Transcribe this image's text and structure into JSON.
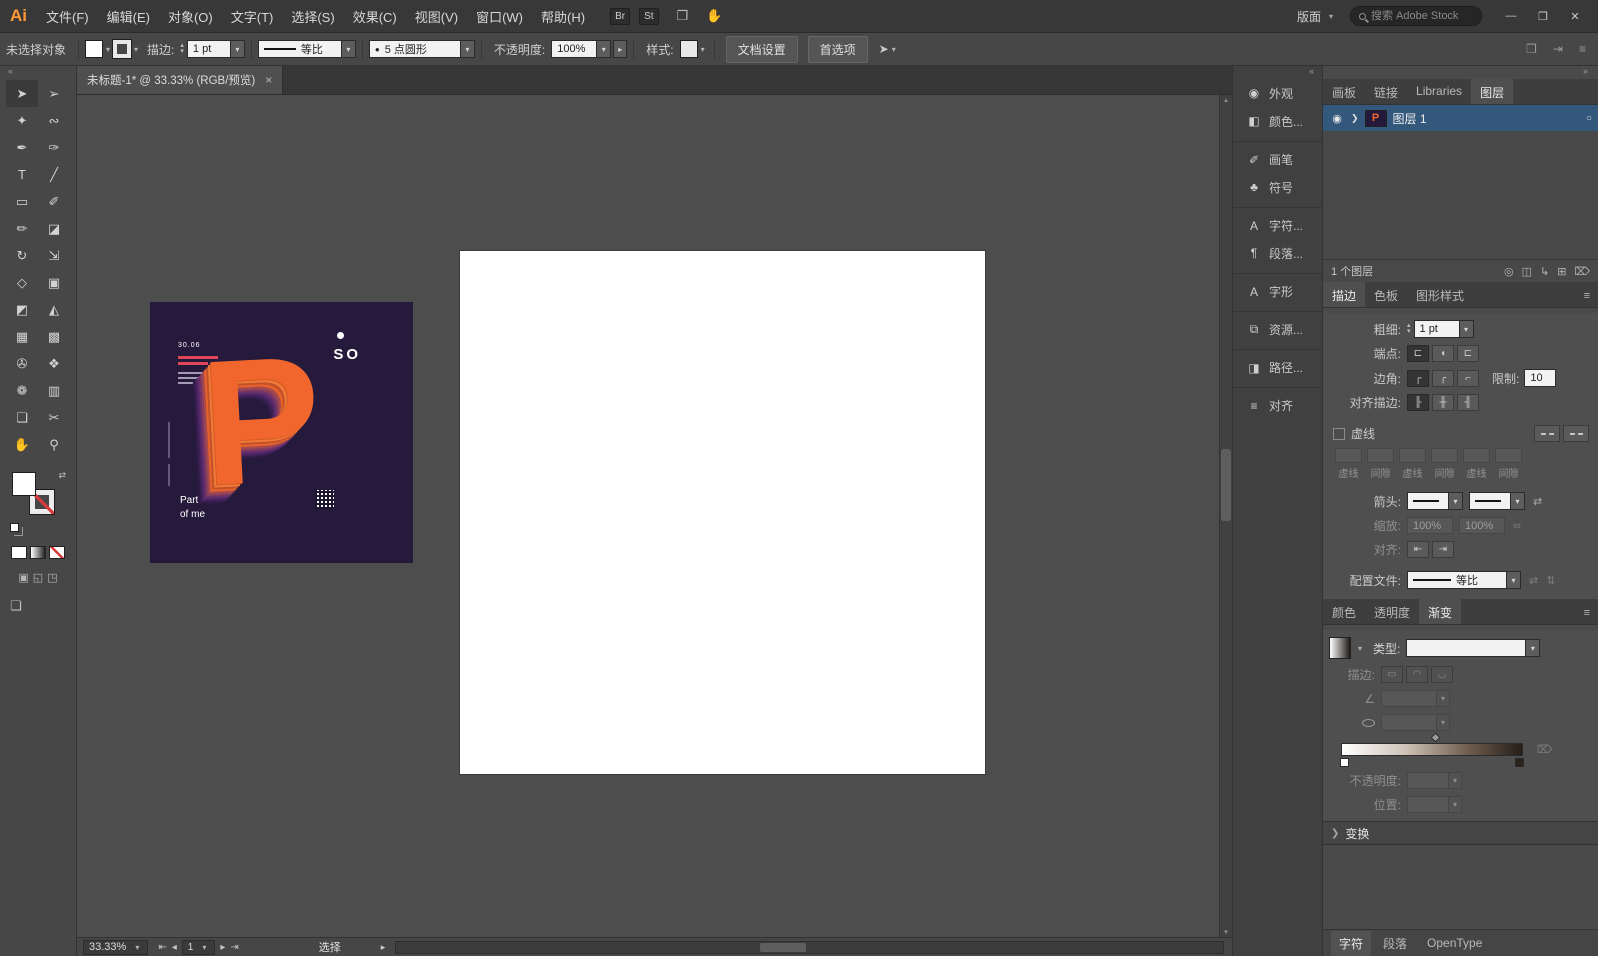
{
  "colors": {
    "selection_blue": "#33587c",
    "poster_orange": "#f0662d",
    "poster_purple": "#251a3c",
    "logo_orange": "#ff9a33"
  },
  "icons": {
    "dropdown": "▾",
    "spin_up": "▴",
    "spin_down": "▾",
    "expand": "❯",
    "hamburger": "≡",
    "collapse_left": "«",
    "collapse_right": "»",
    "swap": "⇄",
    "flip_h": "⇄",
    "flip_v": "⇅",
    "link": "∞",
    "trash": "⌦",
    "target": "○",
    "eye": "◉",
    "new_layer": "⊞",
    "sublayer": "↳",
    "locate": "◎",
    "mask": "◫",
    "arrange": "❒",
    "touch": "✋",
    "pointer": "➤",
    "angle": "∠",
    "minimize": "—",
    "maximize": "❐",
    "close": "✕",
    "tab_close": "×",
    "prev": "◂",
    "next": "▸",
    "first": "⇤",
    "last": "⇥",
    "dot": "●",
    "grid": "❒",
    "send": "⇥",
    "draw_normal": "▣",
    "draw_behind": "◱",
    "draw_inside": "◳",
    "screen_mode": "❏"
  },
  "menubar": {
    "logo": "Ai",
    "items": [
      {
        "name": "menu-file",
        "label": "文件(F)"
      },
      {
        "name": "menu-edit",
        "label": "编辑(E)"
      },
      {
        "name": "menu-object",
        "label": "对象(O)"
      },
      {
        "name": "menu-type",
        "label": "文字(T)"
      },
      {
        "name": "menu-select",
        "label": "选择(S)"
      },
      {
        "name": "menu-effect",
        "label": "效果(C)"
      },
      {
        "name": "menu-view",
        "label": "视图(V)"
      },
      {
        "name": "menu-window",
        "label": "窗口(W)"
      },
      {
        "name": "menu-help",
        "label": "帮助(H)"
      }
    ],
    "bridge": "Br",
    "stock": "St",
    "workspace": "版面",
    "search_placeholder": "搜索 Adobe Stock"
  },
  "controlbar": {
    "no_selection": "未选择对象",
    "stroke_label": "描边:",
    "stroke_width": "1 pt",
    "profile_value": "等比",
    "brush_value": "5 点圆形",
    "opacity_label": "不透明度:",
    "opacity_value": "100%",
    "style_label": "样式:",
    "doc_setup": "文档设置",
    "preferences": "首选项"
  },
  "doc_tab": {
    "title": "未标题-1* @ 33.33% (RGB/预览)"
  },
  "tools": [
    {
      "name": "selection-tool",
      "glyph": "➤",
      "cls": "on"
    },
    {
      "name": "direct-selection-tool",
      "glyph": "➢"
    },
    {
      "name": "magic-wand-tool",
      "glyph": "✦"
    },
    {
      "name": "lasso-tool",
      "glyph": "∾"
    },
    {
      "name": "pen-tool",
      "glyph": "✒"
    },
    {
      "name": "curvature-tool",
      "glyph": "✑"
    },
    {
      "name": "type-tool",
      "glyph": "T"
    },
    {
      "name": "line-segment-tool",
      "glyph": "╱"
    },
    {
      "name": "rectangle-tool",
      "glyph": "▭"
    },
    {
      "name": "paintbrush-tool",
      "glyph": "✐"
    },
    {
      "name": "pencil-tool",
      "glyph": "✏"
    },
    {
      "name": "eraser-tool",
      "glyph": "◪"
    },
    {
      "name": "rotate-tool",
      "glyph": "↻"
    },
    {
      "name": "scale-tool",
      "glyph": "⇲"
    },
    {
      "name": "width-tool",
      "glyph": "◇"
    },
    {
      "name": "free-transform-tool",
      "glyph": "▣"
    },
    {
      "name": "shape-builder-tool",
      "glyph": "◩"
    },
    {
      "name": "perspective-grid-tool",
      "glyph": "◭"
    },
    {
      "name": "mesh-tool",
      "glyph": "▦"
    },
    {
      "name": "gradient-tool",
      "glyph": "▩"
    },
    {
      "name": "eyedropper-tool",
      "glyph": "✇"
    },
    {
      "name": "blend-tool",
      "glyph": "❖"
    },
    {
      "name": "symbol-sprayer-tool",
      "glyph": "❁"
    },
    {
      "name": "column-graph-tool",
      "glyph": "▥"
    },
    {
      "name": "artboard-tool",
      "glyph": "❏"
    },
    {
      "name": "slice-tool",
      "glyph": "✂"
    },
    {
      "name": "hand-tool",
      "glyph": "✋"
    },
    {
      "name": "zoom-tool",
      "glyph": "⚲"
    }
  ],
  "panel_buttons": [
    {
      "name": "panel-button-appearance",
      "label": "外观",
      "icon": "◉"
    },
    {
      "name": "panel-button-color",
      "label": "颜色...",
      "icon": "◧"
    },
    {
      "name": "panel-button-brushes",
      "label": "画笔",
      "icon": "✐",
      "cls": "divided"
    },
    {
      "name": "panel-button-symbols",
      "label": "符号",
      "icon": "♣"
    },
    {
      "name": "panel-button-character",
      "label": "字符...",
      "icon": "A",
      "cls": "divided"
    },
    {
      "name": "panel-button-paragraph",
      "label": "段落...",
      "icon": "¶"
    },
    {
      "name": "panel-button-glyphs",
      "label": "字形",
      "icon": "A",
      "cls": "divided"
    },
    {
      "name": "panel-button-asset-export",
      "label": "资源...",
      "icon": "⧉",
      "cls": "divided"
    },
    {
      "name": "panel-button-pathfinder",
      "label": "路径...",
      "icon": "◨",
      "cls": "divided"
    },
    {
      "name": "panel-button-align",
      "label": "对齐",
      "icon": "≡",
      "cls": "divided"
    }
  ],
  "dock": {
    "tabs": [
      {
        "name": "tab-artboards",
        "label": "画板"
      },
      {
        "name": "tab-links",
        "label": "链接"
      },
      {
        "name": "tab-libraries",
        "label": "Libraries"
      },
      {
        "name": "tab-layers",
        "label": "图层",
        "cls": "active"
      }
    ],
    "layer": {
      "name": "图层 1",
      "thumb_letter": "P"
    },
    "layers_count": "1 个图层",
    "stroke": {
      "tabs": [
        {
          "name": "tab-stroke",
          "label": "描边",
          "cls": "active"
        },
        {
          "name": "tab-swatches",
          "label": "色板"
        },
        {
          "name": "tab-graphic-styles",
          "label": "图形样式"
        }
      ],
      "weight_label": "粗细:",
      "weight_value": "1 pt",
      "cap_label": "端点:",
      "caps": [
        {
          "name": "cap-butt-button",
          "g": "⊏",
          "cls": "on"
        },
        {
          "name": "cap-round-button",
          "g": "◖"
        },
        {
          "name": "cap-projecting-button",
          "g": "⊏"
        }
      ],
      "corner_label": "边角:",
      "joins": [
        {
          "name": "join-miter-button",
          "g": "┌",
          "cls": "on"
        },
        {
          "name": "join-round-button",
          "g": "╭"
        },
        {
          "name": "join-bevel-button",
          "g": "⌐"
        }
      ],
      "limit_label": "限制:",
      "limit_value": "10",
      "align_label": "对齐描边:",
      "aligns": [
        {
          "name": "align-stroke-center-button",
          "g": "╟",
          "cls": "on"
        },
        {
          "name": "align-stroke-inside-button",
          "g": "╫"
        },
        {
          "name": "align-stroke-outside-button",
          "g": "╢"
        }
      ],
      "dashed_label": "虚线",
      "dash_labels": [
        {
          "name": "dash-field-1",
          "label": "虚线"
        },
        {
          "name": "gap-field-1",
          "label": "间隙"
        },
        {
          "name": "dash-field-2",
          "label": "虚线"
        },
        {
          "name": "gap-field-2",
          "label": "间隙"
        },
        {
          "name": "dash-field-3",
          "label": "虚线"
        },
        {
          "name": "gap-field-3",
          "label": "间隙"
        }
      ],
      "arrow_label": "箭头:",
      "scale_label": "缩放:",
      "scale_x": "100%",
      "scale_y": "100%",
      "align2_label": "对齐:",
      "align2_btns": [
        {
          "name": "arrow-align-start-button",
          "g": "⇤"
        },
        {
          "name": "arrow-align-end-button",
          "g": "⇥"
        }
      ],
      "profile_label": "配置文件:",
      "profile_value": "等比"
    },
    "color_tabs": [
      {
        "name": "tab-color",
        "label": "颜色"
      },
      {
        "name": "tab-transparency",
        "label": "透明度"
      },
      {
        "name": "tab-gradient",
        "label": "渐变",
        "cls": "active"
      }
    ],
    "gradient": {
      "type_label": "类型:",
      "stroke_label": "描边:",
      "stroke_btns": [
        {
          "name": "gradient-within-stroke-button",
          "g": "▭"
        },
        {
          "name": "gradient-along-stroke-button",
          "g": "◠"
        },
        {
          "name": "gradient-across-stroke-button",
          "g": "◡"
        }
      ],
      "opacity_label": "不透明度:",
      "position_label": "位置:"
    },
    "transform_label": "变换",
    "bottom_tabs": [
      {
        "name": "tab-character",
        "label": "字符",
        "cls": "first"
      },
      {
        "name": "tab-paragraph",
        "label": "段落"
      },
      {
        "name": "tab-opentype",
        "label": "OpenType"
      }
    ]
  },
  "statusbar": {
    "zoom": "33.33%",
    "page": "1",
    "status": "选择"
  },
  "poster": {
    "date": "30.06",
    "brand": "SO",
    "letter": "P",
    "caption1": "Part",
    "caption2": "of me"
  }
}
